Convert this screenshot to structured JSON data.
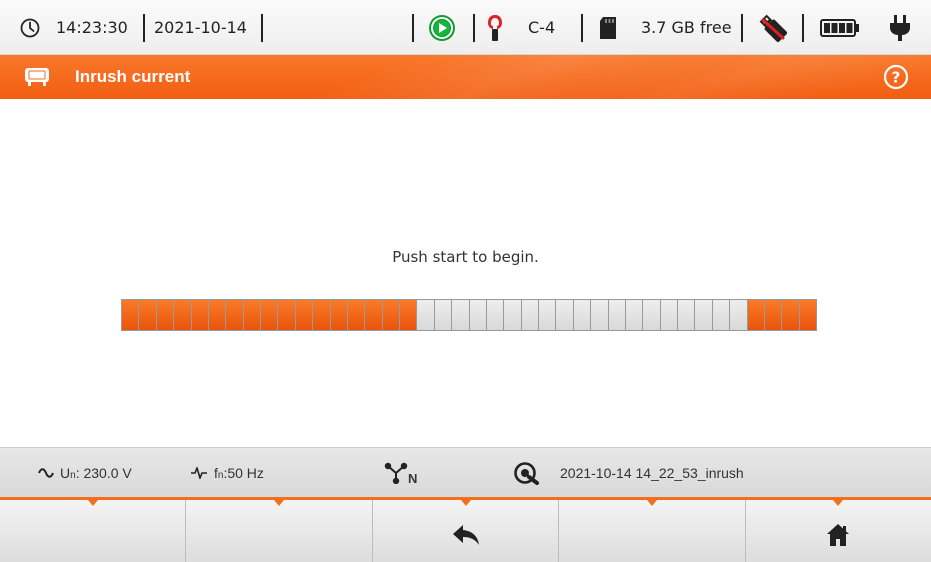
{
  "status": {
    "time": "14:23:30",
    "date": "2021-10-14",
    "clamp_label": "C-4",
    "storage_free": "3.7 GB free",
    "icons": [
      "clock-icon",
      "record-status-icon",
      "current-clamp-icon",
      "sd-card-icon",
      "usb-disconnected-icon",
      "battery-icon",
      "power-plug-icon"
    ]
  },
  "title": {
    "text": "Inrush current",
    "icons": [
      "measurement-mode-icon",
      "help-icon"
    ]
  },
  "main": {
    "message": "Push start to begin.",
    "progress": {
      "total_segments": 40,
      "active_segments": [
        0,
        1,
        2,
        3,
        4,
        5,
        6,
        7,
        8,
        9,
        10,
        11,
        12,
        13,
        14,
        15,
        16,
        17,
        18,
        19,
        20,
        21,
        22,
        23,
        24,
        25,
        26,
        27,
        28,
        29,
        30,
        31,
        32,
        33,
        34,
        35,
        36,
        37,
        38,
        39
      ],
      "filled_from_start": 17,
      "filled_at_end": 4
    }
  },
  "info": {
    "voltage": "Uₙ: 230.0 V",
    "voltage_prefix": "U",
    "voltage_sub": "n",
    "voltage_value": ": 230.0 V",
    "freq_prefix": "f",
    "freq_sub": "n",
    "freq_value": ":50 Hz",
    "network_type_label": "N",
    "filename": "2021-10-14 14_22_53_inrush"
  },
  "buttons": [
    {
      "label": "",
      "icon": ""
    },
    {
      "label": "",
      "icon": ""
    },
    {
      "label": "",
      "icon": "back-arrow-icon"
    },
    {
      "label": "",
      "icon": ""
    },
    {
      "label": "",
      "icon": "home-icon"
    }
  ],
  "colors": {
    "accent": "#f26a1b",
    "progress_on": "#f26a1b",
    "progress_off": "#e3e3e3"
  }
}
